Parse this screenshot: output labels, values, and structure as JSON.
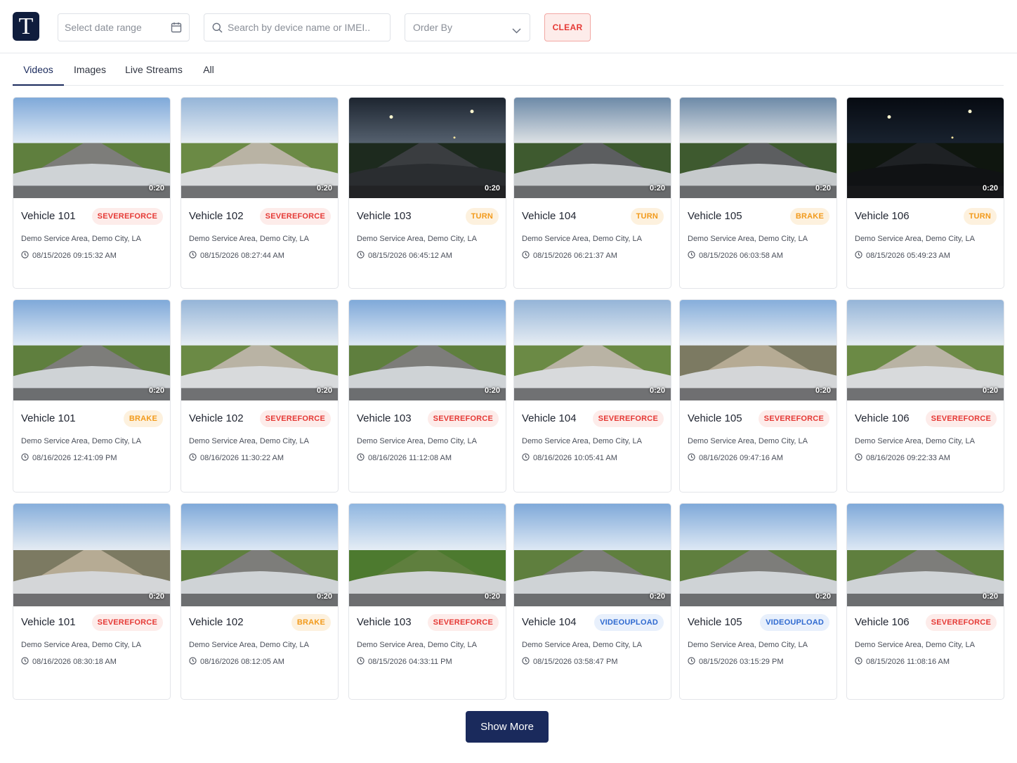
{
  "app": {
    "logo_letter": "T",
    "brand_color": "#0f1d3d",
    "accent_color": "#1a2a5c"
  },
  "filters": {
    "date_placeholder": "Select date range",
    "search_placeholder": "Search by device name or IMEI..",
    "order_by_label": "Order By",
    "clear_label": "CLEAR"
  },
  "tabs": [
    {
      "label": "Videos",
      "active": true
    },
    {
      "label": "Images",
      "active": false
    },
    {
      "label": "Live Streams",
      "active": false
    },
    {
      "label": "All",
      "active": false
    }
  ],
  "cards": [
    {
      "vehicle": "Vehicle 101",
      "event": "SEVEREFORCE",
      "badge": "red",
      "location": "Demo Service Area, Demo City, LA",
      "timestamp": "08/15/2026 09:15:32 AM",
      "duration": "0:20",
      "scene": "day"
    },
    {
      "vehicle": "Vehicle 102",
      "event": "SEVEREFORCE",
      "badge": "red",
      "location": "Demo Service Area, Demo City, LA",
      "timestamp": "08/15/2026 08:27:44 AM",
      "duration": "0:20",
      "scene": "gravel"
    },
    {
      "vehicle": "Vehicle 103",
      "event": "TURN",
      "badge": "orange",
      "location": "Demo Service Area, Demo City, LA",
      "timestamp": "08/15/2026 06:45:12 AM",
      "duration": "0:20",
      "scene": "dusk"
    },
    {
      "vehicle": "Vehicle 104",
      "event": "TURN",
      "badge": "orange",
      "location": "Demo Service Area, Demo City, LA",
      "timestamp": "08/15/2026 06:21:37 AM",
      "duration": "0:20",
      "scene": "dawn"
    },
    {
      "vehicle": "Vehicle 105",
      "event": "BRAKE",
      "badge": "orange",
      "location": "Demo Service Area, Demo City, LA",
      "timestamp": "08/15/2026 06:03:58 AM",
      "duration": "0:20",
      "scene": "dawn"
    },
    {
      "vehicle": "Vehicle 106",
      "event": "TURN",
      "badge": "orange",
      "location": "Demo Service Area, Demo City, LA",
      "timestamp": "08/15/2026 05:49:23 AM",
      "duration": "0:20",
      "scene": "night"
    },
    {
      "vehicle": "Vehicle 101",
      "event": "BRAKE",
      "badge": "orange",
      "location": "Demo Service Area, Demo City, LA",
      "timestamp": "08/16/2026 12:41:09 PM",
      "duration": "0:20",
      "scene": "day"
    },
    {
      "vehicle": "Vehicle 102",
      "event": "SEVEREFORCE",
      "badge": "red",
      "location": "Demo Service Area, Demo City, LA",
      "timestamp": "08/16/2026 11:30:22 AM",
      "duration": "0:20",
      "scene": "gravel"
    },
    {
      "vehicle": "Vehicle 103",
      "event": "SEVEREFORCE",
      "badge": "red",
      "location": "Demo Service Area, Demo City, LA",
      "timestamp": "08/16/2026 11:12:08 AM",
      "duration": "0:20",
      "scene": "day"
    },
    {
      "vehicle": "Vehicle 104",
      "event": "SEVEREFORCE",
      "badge": "red",
      "location": "Demo Service Area, Demo City, LA",
      "timestamp": "08/16/2026 10:05:41 AM",
      "duration": "0:20",
      "scene": "gravel"
    },
    {
      "vehicle": "Vehicle 105",
      "event": "SEVEREFORCE",
      "badge": "red",
      "location": "Demo Service Area, Demo City, LA",
      "timestamp": "08/16/2026 09:47:16 AM",
      "duration": "0:20",
      "scene": "sand"
    },
    {
      "vehicle": "Vehicle 106",
      "event": "SEVEREFORCE",
      "badge": "red",
      "location": "Demo Service Area, Demo City, LA",
      "timestamp": "08/16/2026 09:22:33 AM",
      "duration": "0:20",
      "scene": "gravel"
    },
    {
      "vehicle": "Vehicle 101",
      "event": "SEVEREFORCE",
      "badge": "red",
      "location": "Demo Service Area, Demo City, LA",
      "timestamp": "08/16/2026 08:30:18 AM",
      "duration": "0:20",
      "scene": "sand"
    },
    {
      "vehicle": "Vehicle 102",
      "event": "BRAKE",
      "badge": "orange",
      "location": "Demo Service Area, Demo City, LA",
      "timestamp": "08/16/2026 08:12:05 AM",
      "duration": "0:20",
      "scene": "day"
    },
    {
      "vehicle": "Vehicle 103",
      "event": "SEVEREFORCE",
      "badge": "red",
      "location": "Demo Service Area, Demo City, LA",
      "timestamp": "08/15/2026 04:33:11 PM",
      "duration": "0:20",
      "scene": "grass"
    },
    {
      "vehicle": "Vehicle 104",
      "event": "VIDEOUPLOAD",
      "badge": "blue",
      "location": "Demo Service Area, Demo City, LA",
      "timestamp": "08/15/2026 03:58:47 PM",
      "duration": "0:20",
      "scene": "day"
    },
    {
      "vehicle": "Vehicle 105",
      "event": "VIDEOUPLOAD",
      "badge": "blue",
      "location": "Demo Service Area, Demo City, LA",
      "timestamp": "08/15/2026 03:15:29 PM",
      "duration": "0:20",
      "scene": "day"
    },
    {
      "vehicle": "Vehicle 106",
      "event": "SEVEREFORCE",
      "badge": "red",
      "location": "Demo Service Area, Demo City, LA",
      "timestamp": "08/15/2026 11:08:16 AM",
      "duration": "0:20",
      "scene": "day"
    }
  ],
  "show_more_label": "Show More"
}
